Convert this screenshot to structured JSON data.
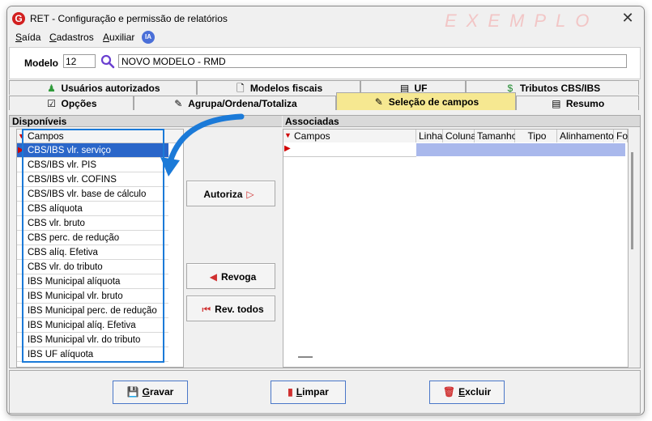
{
  "window": {
    "title": "RET - Configuração e permissão de relatórios",
    "watermark": "EXEMPLO",
    "close_label": "✕"
  },
  "app": {
    "icon_letter": "G"
  },
  "menu": [
    "Saída",
    "Cadastros",
    "Auxiliar"
  ],
  "ia_badge": "IA",
  "model": {
    "label": "Modelo",
    "code": "12",
    "name": "NOVO MODELO - RMD"
  },
  "tabs_row1": [
    {
      "label": "Usuários autorizados",
      "icon": "users-icon"
    },
    {
      "label": "Modelos fiscais",
      "icon": "document-icon"
    },
    {
      "label": "UF",
      "icon": "document-icon"
    },
    {
      "label": "Tributos CBS/IBS",
      "icon": "money-icon"
    }
  ],
  "tabs_row2": [
    {
      "label": "Opções",
      "icon": "checkbox-icon"
    },
    {
      "label": "Agrupa/Ordena/Totaliza",
      "icon": "edit-icon"
    },
    {
      "label": "Seleção de campos",
      "icon": "edit-icon",
      "active": true
    },
    {
      "label": "Resumo",
      "icon": "document-icon"
    }
  ],
  "available": {
    "header": "Disponíveis",
    "column": "Campos",
    "items": [
      "CBS/IBS vlr. serviço",
      "CBS/IBS vlr. PIS",
      "CBS/IBS vlr. COFINS",
      "CBS/IBS vlr. base de cálculo",
      "CBS alíquota",
      "CBS vlr. bruto",
      "CBS perc. de redução",
      "CBS alíq. Efetiva",
      "CBS vlr. do tributo",
      "IBS Municipal alíquota",
      "IBS Municipal vlr. bruto",
      "IBS Municipal perc. de redução",
      "IBS Municipal alíq. Efetiva",
      "IBS Municipal vlr. do tributo",
      "IBS UF alíquota"
    ],
    "selected_index": 0
  },
  "actions": {
    "autoriza": "Autoriza",
    "revoga": "Revoga",
    "revoga_todos": "Rev. todos"
  },
  "associated": {
    "header": "Associadas",
    "columns": [
      "Campos",
      "Linha",
      "Coluna",
      "Tamanho",
      "Tipo",
      "Alinhamento",
      "Fo"
    ]
  },
  "footer": {
    "gravar": "Gravar",
    "limpar": "Limpar",
    "excluir": "Excluir"
  },
  "colors": {
    "selection": "#2a66c9",
    "active_tab": "#f6e891",
    "highlight": "#1b7ad8",
    "row_marker": "#d00000",
    "assoc_row": "#a9b8ec"
  }
}
